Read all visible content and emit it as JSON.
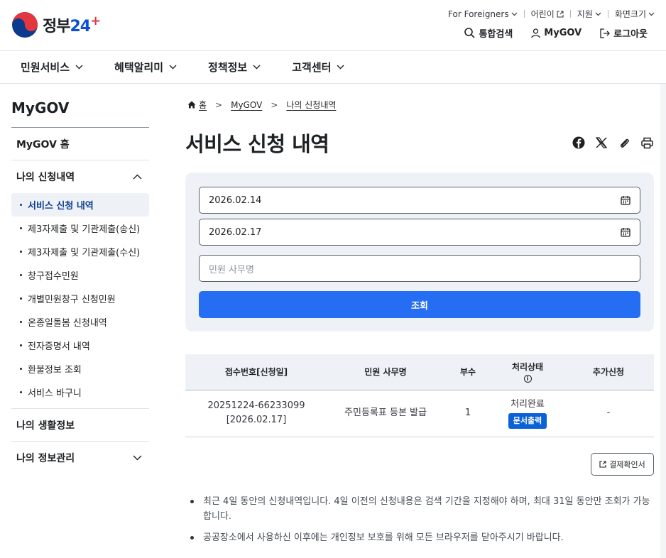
{
  "header": {
    "logo": {
      "text": "정부",
      "num": "24"
    },
    "util_links": [
      {
        "label": "For Foreigners"
      },
      {
        "label": "어린이"
      },
      {
        "label": "지원"
      },
      {
        "label": "화면크기"
      }
    ],
    "top_nav": [
      {
        "label": "통합검색",
        "icon": "search-icon"
      },
      {
        "label": "MyGOV",
        "icon": "user-icon"
      },
      {
        "label": "로그아웃",
        "icon": "logout-icon"
      }
    ]
  },
  "gnb": [
    {
      "label": "민원서비스"
    },
    {
      "label": "혜택알리미"
    },
    {
      "label": "정책정보"
    },
    {
      "label": "고객센터"
    }
  ],
  "sidebar": {
    "title": "MyGOV",
    "home": "MyGOV 홈",
    "section_apply": "나의 신청내역",
    "items": [
      {
        "label": "서비스 신청 내역",
        "active": true
      },
      {
        "label": "제3자제출 및 기관제출(송신)"
      },
      {
        "label": "제3자제출 및 기관제출(수신)"
      },
      {
        "label": "창구접수민원"
      },
      {
        "label": "개별민원창구 신청민원"
      },
      {
        "label": "온종일돌봄 신청내역"
      },
      {
        "label": "전자증명서 내역"
      },
      {
        "label": "환불정보 조회"
      },
      {
        "label": "서비스 바구니"
      }
    ],
    "section_life": "나의 생활정보",
    "section_manage": "나의 정보관리"
  },
  "breadcrumb": {
    "home": "홈",
    "mygov": "MyGOV",
    "current": "나의 신청내역",
    "separator": ">"
  },
  "page_title": "서비스 신청 내역",
  "search": {
    "start_date": "2026.02.14",
    "end_date": "2026.02.17",
    "keyword_placeholder": "민원 사무명",
    "button": "조회"
  },
  "table": {
    "headers": {
      "receipt_no": "접수번호[신청일]",
      "service": "민원 사무명",
      "copies": "부수",
      "status": "처리상태",
      "extra": "추가신청"
    },
    "rows": [
      {
        "receipt_no": "20251224-66233099",
        "date": "[2026.02.17]",
        "service": "주민등록표 등본 발급",
        "copies": "1",
        "status": "처리완료",
        "print_button": "문서출력",
        "extra": "-"
      }
    ]
  },
  "receipt_button": "결제확인서",
  "notes": [
    "최근 4일 동안의 신청내역입니다. 4일 이전의 신청내용은 검색 기간을 지정해야 하며, 최대 31일 동안만 조회가 가능합니다.",
    "공공장소에서 사용하신 이후에는 개인정보 보호를 위해 모든 브라우저를 닫아주시기 바랍니다."
  ],
  "colors": {
    "primary": "#256ef4",
    "panel": "#eef2f7",
    "print_button": "#0b61d6"
  }
}
